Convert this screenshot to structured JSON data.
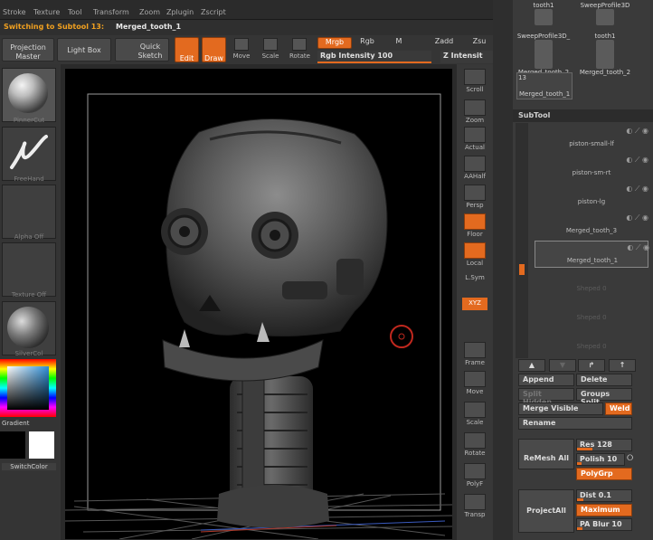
{
  "menu": [
    "Stroke",
    "Texture",
    "Tool",
    "Transform",
    "Zoom",
    "Zplugin",
    "Zscript"
  ],
  "status": {
    "prefix": "Switching to Subtool 13:",
    "name": "Merged_tooth_1"
  },
  "toolbar": {
    "projection_master": "Projection Master",
    "light_box": "Light Box",
    "quick_sketch": "Quick Sketch",
    "edit": "Edit",
    "draw": "Draw",
    "move": "Move",
    "scale": "Scale",
    "rotate": "Rotate",
    "mrgb": "Mrgb",
    "rgb": "Rgb",
    "m": "M",
    "zadd": "Zadd",
    "zsub": "Zsu",
    "rgb_intensity": "Rgb Intensity 100",
    "z_intensity": "Z Intensit"
  },
  "left": {
    "material1": "PinnerCut",
    "stroke": "FreeHand",
    "alpha": "Alpha Off",
    "texture": "Texture Off",
    "material2": "SilverCol",
    "gradient": "Gradient",
    "switchcolor": "SwitchColor"
  },
  "rightstrip": [
    "Scroll",
    "Zoom",
    "Actual",
    "AAHalf",
    "Persp",
    "Floor",
    "Local",
    "L.Sym",
    "XYZ",
    "Frame",
    "Move",
    "Scale",
    "Rotate",
    "PolyF",
    "Transp"
  ],
  "tools": {
    "r0": [
      "tooth1",
      "SweepProfile3D"
    ],
    "r1": [
      "SweepProfile3D_",
      "tooth1"
    ],
    "r2": [
      "Merged_tooth_2",
      "Merged_tooth_2"
    ],
    "count": "13",
    "last": "Merged_tooth_1"
  },
  "subtool": {
    "title": "SubTool",
    "items": [
      "piston-small-lf",
      "piston-sm-rt",
      "piston-lg",
      "Merged_tooth_3",
      "Merged_tooth_1",
      "Sheped 0",
      "Sheped 0",
      "Sheped 0"
    ],
    "append": "Append",
    "delete": "Delete",
    "split_hidden": "Split Hidden",
    "groups_split": "Groups Split",
    "merge_visible": "Merge Visible",
    "weld": "Weld",
    "rename": "Rename",
    "remesh_all": "ReMesh All",
    "res": "Res 128",
    "polish": "Polish 10",
    "polygrp": "PolyGrp",
    "project_all": "ProjectAll",
    "dist": "Dist 0.1",
    "maximum": "Maximum",
    "pa_blur": "PA Blur 10"
  }
}
